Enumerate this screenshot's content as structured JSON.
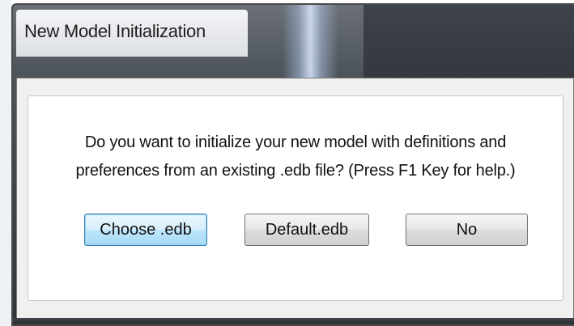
{
  "dialog": {
    "title": "New Model Initialization",
    "message_line1": "Do you want to initialize your new model with definitions and",
    "message_line2": "preferences from an existing .edb file? (Press F1 Key for help.)",
    "buttons": {
      "choose": "Choose .edb",
      "default": "Default.edb",
      "no": "No"
    }
  },
  "colors": {
    "frame": "#3d4349",
    "client_bg": "#f0f0f0",
    "panel_bg": "#ffffff",
    "default_button_border": "#3c7fb1"
  }
}
